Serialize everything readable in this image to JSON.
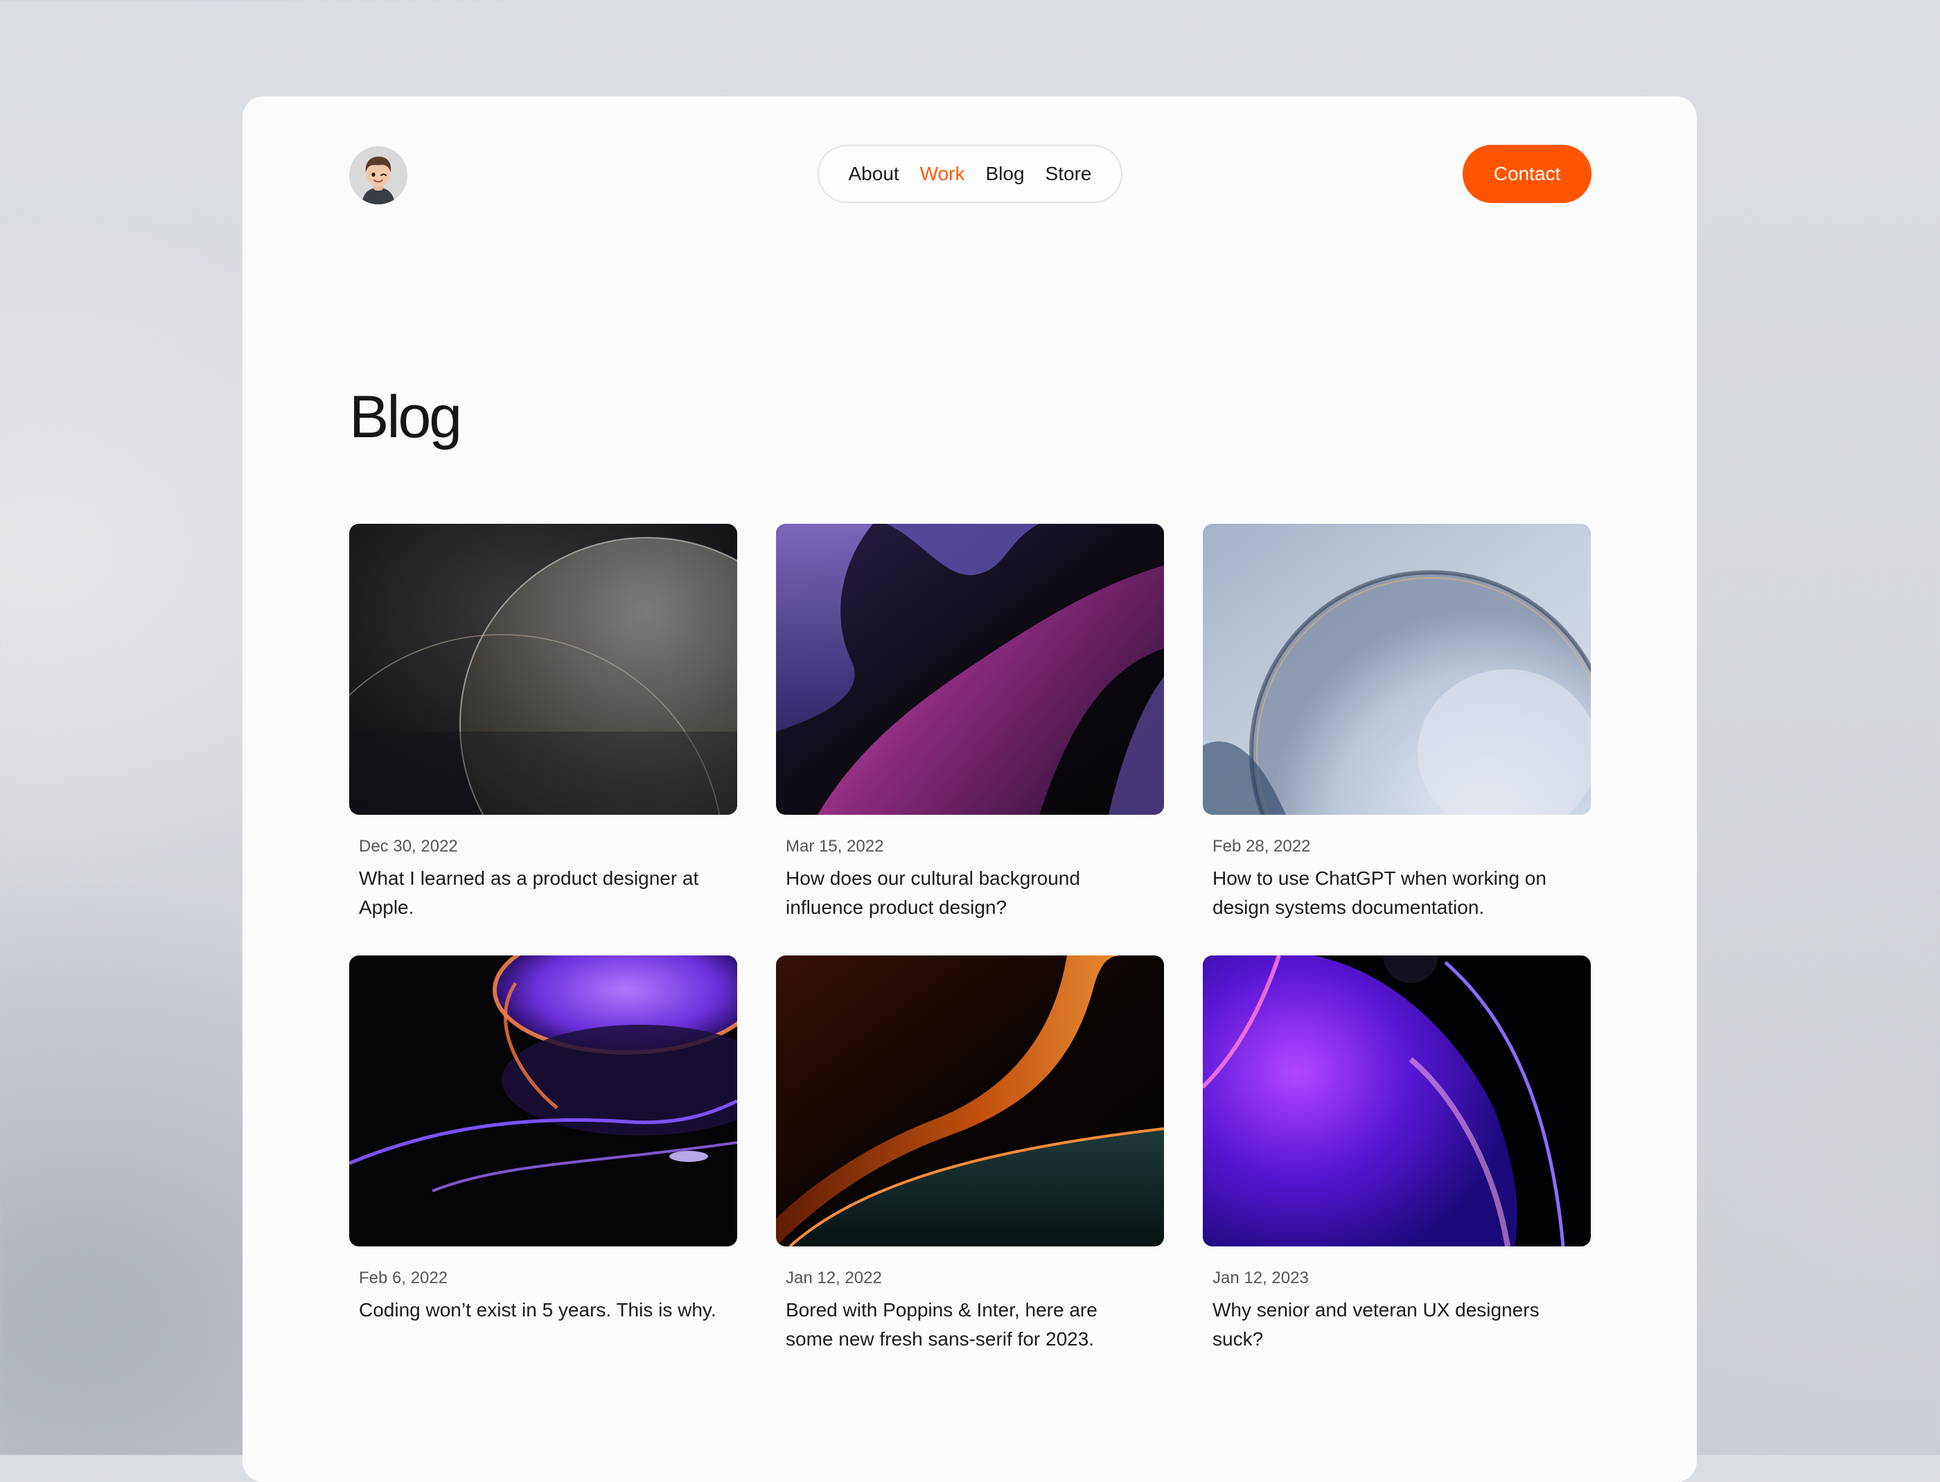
{
  "header": {
    "avatar_alt": "Profile avatar",
    "nav": [
      {
        "label": "About",
        "active": false
      },
      {
        "label": "Work",
        "active": true
      },
      {
        "label": "Blog",
        "active": false
      },
      {
        "label": "Store",
        "active": false
      }
    ],
    "contact_label": "Contact"
  },
  "page": {
    "title": "Blog"
  },
  "posts": [
    {
      "date": "Dec 30, 2022",
      "title": "What I learned as a product designer at Apple."
    },
    {
      "date": "Mar 15, 2022",
      "title": "How does our cultural background influence product design?"
    },
    {
      "date": "Feb 28, 2022",
      "title": "How to use ChatGPT when working on design systems documentation."
    },
    {
      "date": "Feb 6, 2022",
      "title": "Coding won’t exist in 5 years. This is why."
    },
    {
      "date": "Jan 12, 2022",
      "title": "Bored with Poppins & Inter, here are some new fresh sans-serif for 2023."
    },
    {
      "date": "Jan 12, 2023",
      "title": "Why senior and veteran UX designers suck?"
    }
  ],
  "colors": {
    "accent": "#ff5500",
    "active_nav": "#ff5a0a",
    "card_background": "#fbfbfb"
  }
}
